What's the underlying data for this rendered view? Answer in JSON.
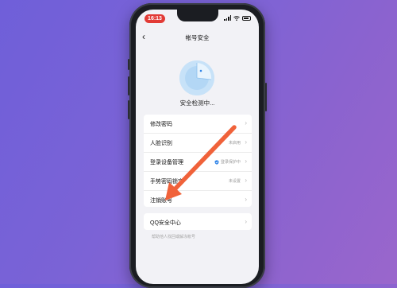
{
  "status_bar": {
    "time": "16:13"
  },
  "nav": {
    "back_glyph": "‹",
    "title": "帐号安全"
  },
  "scan": {
    "status_text": "安全检测中..."
  },
  "menu": {
    "items": [
      {
        "label": "修改密码",
        "value": ""
      },
      {
        "label": "人脸识别",
        "value": "未启用"
      },
      {
        "label": "登录设备管理",
        "value": "登录保护中",
        "icon": "shield-check-icon"
      },
      {
        "label": "手势密码锁定",
        "value": "未设置"
      },
      {
        "label": "注销账号",
        "value": ""
      }
    ]
  },
  "qq_center": {
    "label": "QQ安全中心"
  },
  "footer": {
    "helper_text": "帮助他人找回或解冻帐号"
  },
  "colors": {
    "background_start": "#6f5fd9",
    "background_end": "#9a66cc",
    "time_pill": "#e23b36",
    "shield": "#2f84e8",
    "annotation_arrow": "#f0623a"
  }
}
